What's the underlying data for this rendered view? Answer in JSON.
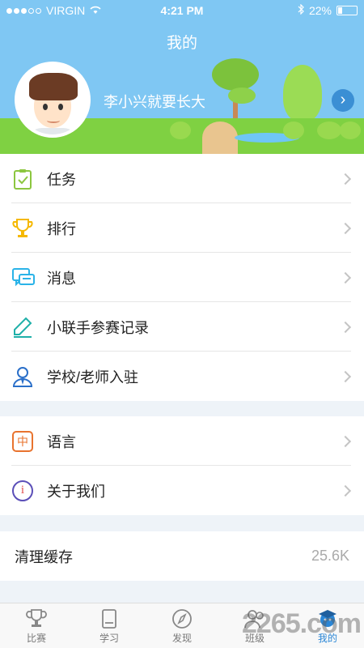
{
  "status": {
    "carrier": "VIRGIN",
    "time": "4:21 PM",
    "battery": "22%",
    "battery_level": 0.22
  },
  "header": {
    "title": "我的"
  },
  "profile": {
    "name": "李小兴就要长大"
  },
  "menu_primary": [
    {
      "label": "任务",
      "icon": "task-icon"
    },
    {
      "label": "排行",
      "icon": "trophy-icon"
    },
    {
      "label": "消息",
      "icon": "message-icon"
    },
    {
      "label": "小联手参赛记录",
      "icon": "pen-icon"
    },
    {
      "label": "学校/老师入驻",
      "icon": "teacher-icon"
    }
  ],
  "menu_secondary": [
    {
      "label": "语言",
      "icon": "language-icon",
      "badge": "中"
    },
    {
      "label": "关于我们",
      "icon": "info-icon",
      "badge": "i"
    }
  ],
  "cache": {
    "label": "清理缓存",
    "value": "25.6K"
  },
  "tabs": [
    {
      "label": "比赛",
      "icon": "trophy-icon"
    },
    {
      "label": "学习",
      "icon": "book-icon"
    },
    {
      "label": "发现",
      "icon": "compass-icon"
    },
    {
      "label": "班级",
      "icon": "class-icon"
    },
    {
      "label": "我的",
      "icon": "graduation-cap-icon",
      "active": true
    }
  ],
  "watermark": "2265.com",
  "colors": {
    "header_bg": "#7fc7f3",
    "accent": "#2a86d6",
    "grass": "#7fd142"
  }
}
